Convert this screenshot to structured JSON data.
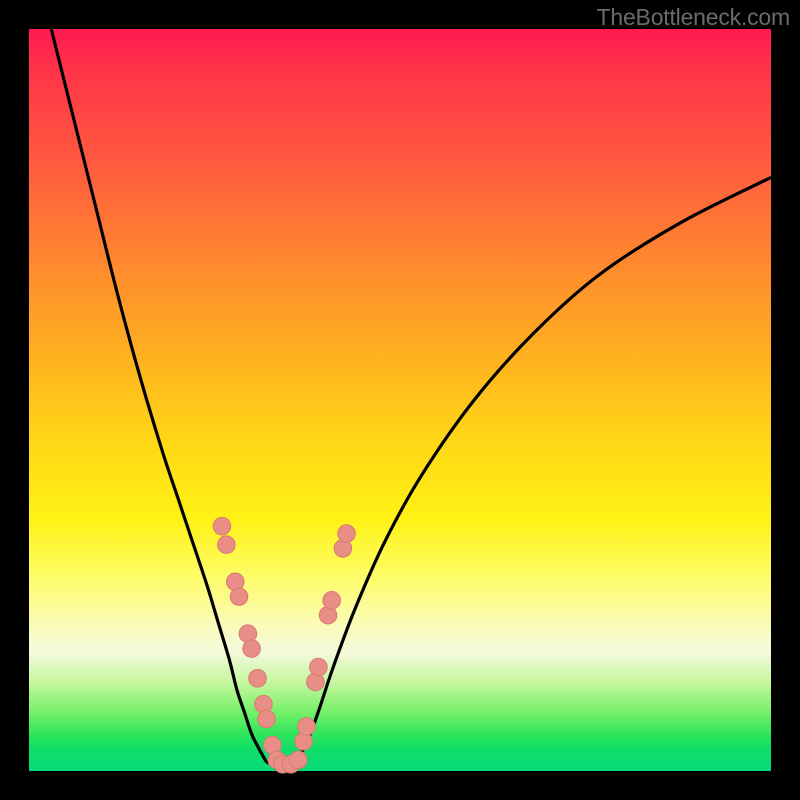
{
  "watermark": "TheBottleneck.com",
  "colors": {
    "frame": "#000000",
    "curve": "#000000",
    "marker_fill": "#e98e86",
    "marker_stroke": "#d97a72",
    "gradient_stops": [
      "#ff1a50",
      "#ff5a3f",
      "#ffb41f",
      "#fff215",
      "#fbfbb5",
      "#78f06a",
      "#08da7a"
    ]
  },
  "chart_data": {
    "type": "line",
    "title": "",
    "xlabel": "",
    "ylabel": "",
    "xlim": [
      0,
      100
    ],
    "ylim": [
      0,
      100
    ],
    "series": [
      {
        "name": "left-curve",
        "x": [
          3,
          6,
          9,
          12,
          15,
          18,
          20,
          22,
          24,
          25.5,
          27,
          28,
          29,
          30,
          31,
          32
        ],
        "y": [
          100,
          88,
          76,
          64,
          53,
          43,
          37,
          31,
          25,
          20,
          15,
          11,
          8,
          5,
          3,
          1.2
        ]
      },
      {
        "name": "right-curve",
        "x": [
          36,
          37.5,
          39,
          41,
          44,
          48,
          53,
          60,
          68,
          77,
          88,
          100
        ],
        "y": [
          1.2,
          4,
          8,
          14,
          22,
          31,
          40,
          50,
          59,
          67,
          74,
          80
        ]
      },
      {
        "name": "valley-floor",
        "x": [
          32,
          33,
          34,
          35,
          36
        ],
        "y": [
          1.2,
          0.9,
          0.8,
          0.9,
          1.2
        ]
      }
    ],
    "markers": {
      "name": "sample-points",
      "points": [
        {
          "x": 26.0,
          "y": 33.0
        },
        {
          "x": 26.6,
          "y": 30.5
        },
        {
          "x": 27.8,
          "y": 25.5
        },
        {
          "x": 28.3,
          "y": 23.5
        },
        {
          "x": 29.5,
          "y": 18.5
        },
        {
          "x": 30.0,
          "y": 16.5
        },
        {
          "x": 30.8,
          "y": 12.5
        },
        {
          "x": 31.6,
          "y": 9.0
        },
        {
          "x": 32.0,
          "y": 7.0
        },
        {
          "x": 32.8,
          "y": 3.5
        },
        {
          "x": 33.4,
          "y": 1.5
        },
        {
          "x": 34.2,
          "y": 0.9
        },
        {
          "x": 35.3,
          "y": 0.9
        },
        {
          "x": 36.3,
          "y": 1.5
        },
        {
          "x": 37.0,
          "y": 4.0
        },
        {
          "x": 37.4,
          "y": 6.0
        },
        {
          "x": 38.6,
          "y": 12.0
        },
        {
          "x": 39.0,
          "y": 14.0
        },
        {
          "x": 40.3,
          "y": 21.0
        },
        {
          "x": 40.8,
          "y": 23.0
        },
        {
          "x": 42.3,
          "y": 30.0
        },
        {
          "x": 42.8,
          "y": 32.0
        }
      ]
    }
  }
}
